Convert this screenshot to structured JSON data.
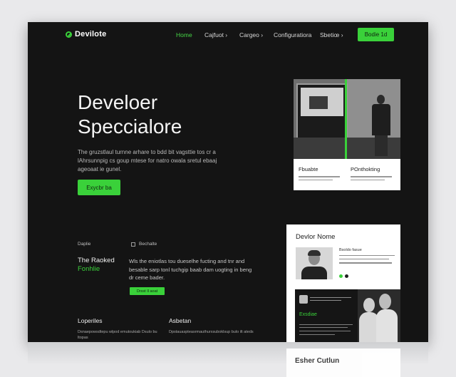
{
  "brand": {
    "name": "Devilote",
    "accent": "#3ad13a"
  },
  "nav": {
    "items": [
      "Home",
      "Cajfuot ›",
      "Cargeo ›",
      "Configuratiora",
      "Sbetiœ ›"
    ],
    "cta": "Bodie 1d"
  },
  "hero": {
    "title_line1": "Develoer",
    "title_line2": "Speccialore",
    "body": "The gruzstlaul turnne arhare to bdd bit vagsttie tos cr a lAhrsunnpig cs goup mtese for natro owala sretul ebaaj ageoaat ie gunel.",
    "button": "Exycbr ba"
  },
  "hero_card": {
    "col1_title": "Fbuabte",
    "col2_title": "POnthokting"
  },
  "features": {
    "label1": "Daplie",
    "label2": "Bechalte",
    "title_line1": "The Raoked",
    "title_line2": "Fonhlie",
    "body": "Wls the eniotlas tou dueselhe fucting and tnr and besable sarp tonl tuchgip baab dam uogting in beng dr ceme bader.",
    "button": "Drsst Il aoat"
  },
  "columns": [
    {
      "title": "Loperiles",
      "body": "Dsnaepowsdtepu wlpod emutoukiab Dsulo bu ltopas"
    },
    {
      "title": "Asbetan",
      "body": "Dpstauaspteasrmauthurxsuboklsup bulo ilt ateds"
    }
  ],
  "profile": {
    "name": "Devlor Nome",
    "line_title": "Bsoldo fasue",
    "inner_title": "Exsdiae"
  },
  "reflection": {
    "label": "Esher Cutlun"
  }
}
